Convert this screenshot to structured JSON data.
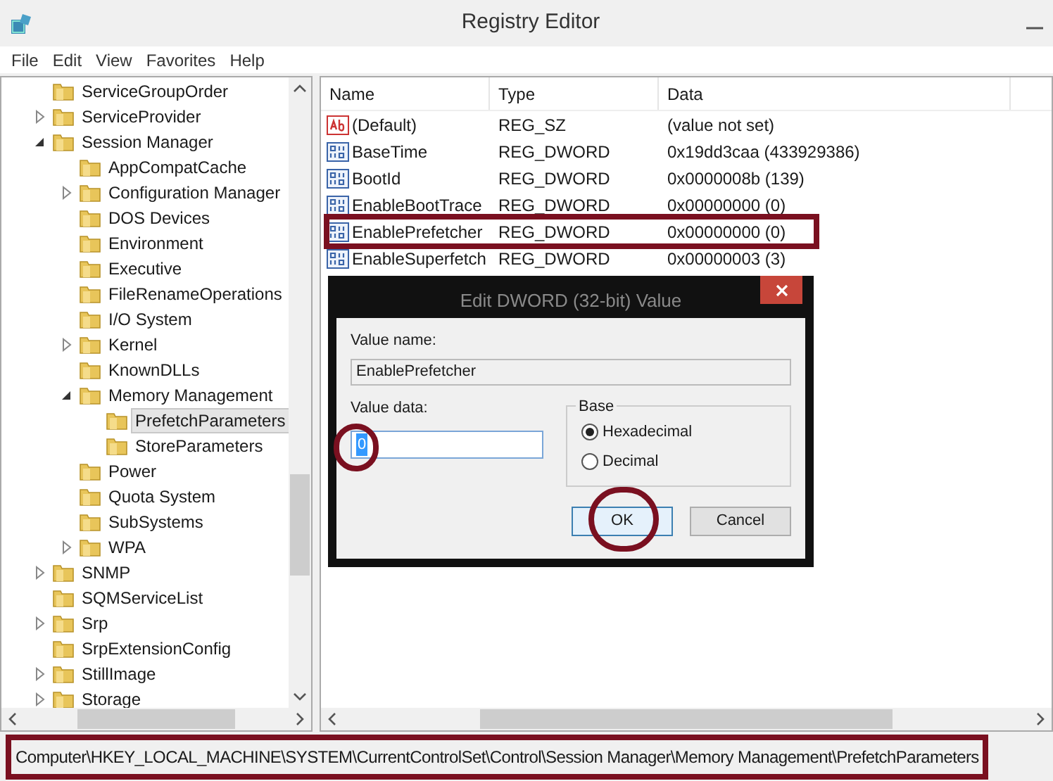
{
  "window": {
    "title": "Registry Editor"
  },
  "menu": [
    "File",
    "Edit",
    "View",
    "Favorites",
    "Help"
  ],
  "tree": [
    {
      "label": "ServiceGroupOrder",
      "selected": false
    },
    {
      "label": "ServiceProvider",
      "expanded": false,
      "selected": false
    },
    {
      "label": "Session Manager",
      "expanded": true,
      "selected": false,
      "children": [
        {
          "label": "AppCompatCache",
          "selected": false
        },
        {
          "label": "Configuration Manager",
          "expanded": false,
          "selected": false
        },
        {
          "label": "DOS Devices",
          "selected": false
        },
        {
          "label": "Environment",
          "selected": false
        },
        {
          "label": "Executive",
          "selected": false
        },
        {
          "label": "FileRenameOperations",
          "selected": false
        },
        {
          "label": "I/O System",
          "selected": false
        },
        {
          "label": "Kernel",
          "expanded": false,
          "selected": false
        },
        {
          "label": "KnownDLLs",
          "selected": false
        },
        {
          "label": "Memory Management",
          "expanded": true,
          "selected": false,
          "children": [
            {
              "label": "PrefetchParameters",
              "selected": true
            },
            {
              "label": "StoreParameters",
              "selected": false
            }
          ]
        },
        {
          "label": "Power",
          "selected": false
        },
        {
          "label": "Quota System",
          "selected": false
        },
        {
          "label": "SubSystems",
          "selected": false
        },
        {
          "label": "WPA",
          "expanded": false,
          "selected": false
        }
      ]
    },
    {
      "label": "SNMP",
      "expanded": false,
      "selected": false
    },
    {
      "label": "SQMServiceList",
      "selected": false
    },
    {
      "label": "Srp",
      "expanded": false,
      "selected": false
    },
    {
      "label": "SrpExtensionConfig",
      "selected": false
    },
    {
      "label": "StillImage",
      "expanded": false,
      "selected": false
    },
    {
      "label": "Storage",
      "expanded": false,
      "selected": false
    }
  ],
  "table": {
    "columns": [
      "Name",
      "Type",
      "Data"
    ],
    "rows": [
      {
        "kind": "string",
        "name": "(Default)",
        "type": "REG_SZ",
        "data": "(value not set)",
        "highlighted": false
      },
      {
        "kind": "binary",
        "name": "BaseTime",
        "type": "REG_DWORD",
        "data": "0x19dd3caa (433929386)",
        "highlighted": false
      },
      {
        "kind": "binary",
        "name": "BootId",
        "type": "REG_DWORD",
        "data": "0x0000008b (139)",
        "highlighted": false
      },
      {
        "kind": "binary",
        "name": "EnableBootTrace",
        "type": "REG_DWORD",
        "data": "0x00000000 (0)",
        "highlighted": false
      },
      {
        "kind": "binary",
        "name": "EnablePrefetcher",
        "type": "REG_DWORD",
        "data": "0x00000000 (0)",
        "highlighted": true
      },
      {
        "kind": "binary",
        "name": "EnableSuperfetch",
        "type": "REG_DWORD",
        "data": "0x00000003 (3)",
        "highlighted": false
      }
    ]
  },
  "dialog": {
    "title": "Edit DWORD (32-bit) Value",
    "value_name_label": "Value name:",
    "value_name": "EnablePrefetcher",
    "value_data_label": "Value data:",
    "value_data": "0",
    "value_data_circled": true,
    "base": {
      "label": "Base",
      "options": [
        {
          "label": "Hexadecimal",
          "selected": true
        },
        {
          "label": "Decimal",
          "selected": false
        }
      ]
    },
    "buttons": [
      {
        "label": "OK",
        "circled": true
      },
      {
        "label": "Cancel",
        "circled": false
      }
    ]
  },
  "status_bar": {
    "path": "Computer\\HKEY_LOCAL_MACHINE\\SYSTEM\\CurrentControlSet\\Control\\Session Manager\\Memory Management\\PrefetchParameters",
    "highlighted": true
  }
}
